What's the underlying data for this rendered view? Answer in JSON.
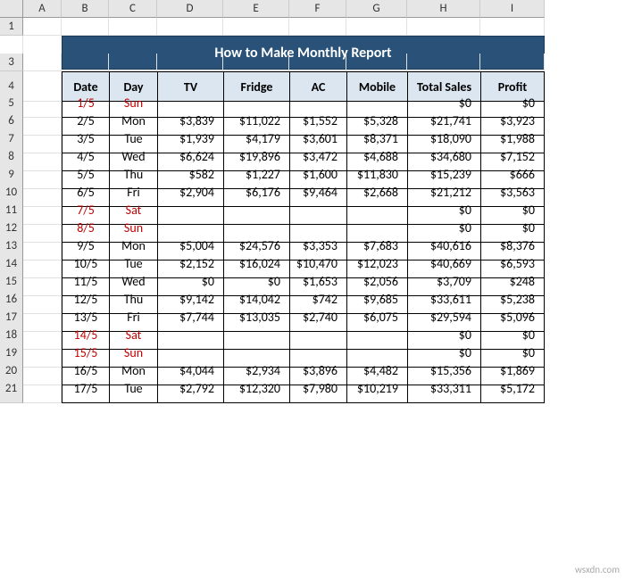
{
  "watermark": "wsxdn.com",
  "columns": [
    "A",
    "B",
    "C",
    "D",
    "E",
    "F",
    "G",
    "H",
    "I"
  ],
  "row_numbers": [
    "1",
    "2",
    "3",
    "4",
    "5",
    "6",
    "7",
    "8",
    "9",
    "10",
    "11",
    "12",
    "13",
    "14",
    "15",
    "16",
    "17",
    "18",
    "19",
    "20",
    "21"
  ],
  "title": "How to Make Monthly Report",
  "headers": [
    "Date",
    "Day",
    "TV",
    "Fridge",
    "AC",
    "Mobile",
    "Total Sales",
    "Profit"
  ],
  "rows": [
    {
      "date": "1/5",
      "day": "Sun",
      "tv": "",
      "fridge": "",
      "ac": "",
      "mobile": "",
      "total": "$0",
      "profit": "$0",
      "weekend": true
    },
    {
      "date": "2/5",
      "day": "Mon",
      "tv": "$3,839",
      "fridge": "$11,022",
      "ac": "$1,552",
      "mobile": "$5,328",
      "total": "$21,741",
      "profit": "$3,923",
      "weekend": false
    },
    {
      "date": "3/5",
      "day": "Tue",
      "tv": "$1,939",
      "fridge": "$4,179",
      "ac": "$3,601",
      "mobile": "$8,371",
      "total": "$18,090",
      "profit": "$1,988",
      "weekend": false
    },
    {
      "date": "4/5",
      "day": "Wed",
      "tv": "$6,624",
      "fridge": "$19,896",
      "ac": "$3,472",
      "mobile": "$4,688",
      "total": "$34,680",
      "profit": "$7,152",
      "weekend": false
    },
    {
      "date": "5/5",
      "day": "Thu",
      "tv": "$582",
      "fridge": "$1,227",
      "ac": "$1,600",
      "mobile": "$11,830",
      "total": "$15,239",
      "profit": "$666",
      "weekend": false
    },
    {
      "date": "6/5",
      "day": "Fri",
      "tv": "$2,904",
      "fridge": "$6,176",
      "ac": "$9,464",
      "mobile": "$2,668",
      "total": "$21,212",
      "profit": "$3,563",
      "weekend": false
    },
    {
      "date": "7/5",
      "day": "Sat",
      "tv": "",
      "fridge": "",
      "ac": "",
      "mobile": "",
      "total": "$0",
      "profit": "$0",
      "weekend": true
    },
    {
      "date": "8/5",
      "day": "Sun",
      "tv": "",
      "fridge": "",
      "ac": "",
      "mobile": "",
      "total": "$0",
      "profit": "$0",
      "weekend": true
    },
    {
      "date": "9/5",
      "day": "Mon",
      "tv": "$5,004",
      "fridge": "$24,576",
      "ac": "$3,353",
      "mobile": "$7,683",
      "total": "$40,616",
      "profit": "$8,376",
      "weekend": false
    },
    {
      "date": "10/5",
      "day": "Tue",
      "tv": "$2,152",
      "fridge": "$16,024",
      "ac": "$10,470",
      "mobile": "$12,023",
      "total": "$40,669",
      "profit": "$6,593",
      "weekend": false
    },
    {
      "date": "11/5",
      "day": "Wed",
      "tv": "$0",
      "fridge": "$0",
      "ac": "$1,653",
      "mobile": "$2,056",
      "total": "$3,709",
      "profit": "$248",
      "weekend": false
    },
    {
      "date": "12/5",
      "day": "Thu",
      "tv": "$9,142",
      "fridge": "$14,042",
      "ac": "$742",
      "mobile": "$9,685",
      "total": "$33,611",
      "profit": "$5,238",
      "weekend": false
    },
    {
      "date": "13/5",
      "day": "Fri",
      "tv": "$7,744",
      "fridge": "$13,035",
      "ac": "$2,740",
      "mobile": "$6,075",
      "total": "$29,594",
      "profit": "$5,096",
      "weekend": false
    },
    {
      "date": "14/5",
      "day": "Sat",
      "tv": "",
      "fridge": "",
      "ac": "",
      "mobile": "",
      "total": "$0",
      "profit": "$0",
      "weekend": true
    },
    {
      "date": "15/5",
      "day": "Sun",
      "tv": "",
      "fridge": "",
      "ac": "",
      "mobile": "",
      "total": "$0",
      "profit": "$0",
      "weekend": true
    },
    {
      "date": "16/5",
      "day": "Mon",
      "tv": "$4,044",
      "fridge": "$2,934",
      "ac": "$3,896",
      "mobile": "$4,482",
      "total": "$15,356",
      "profit": "$1,869",
      "weekend": false
    },
    {
      "date": "17/5",
      "day": "Tue",
      "tv": "$2,792",
      "fridge": "$12,320",
      "ac": "$7,980",
      "mobile": "$10,219",
      "total": "$33,311",
      "profit": "$5,172",
      "weekend": false
    }
  ]
}
